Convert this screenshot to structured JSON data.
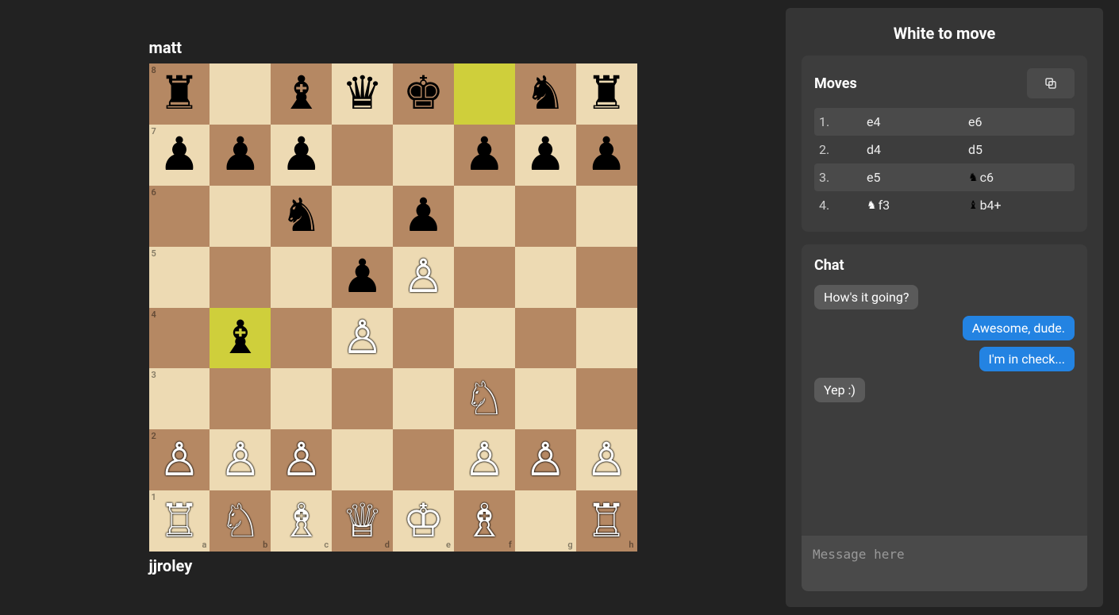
{
  "players": {
    "top": "matt",
    "bottom": "jjroley"
  },
  "turn": "White to move",
  "highlights": [
    "f8",
    "b4"
  ],
  "board": {
    "a8": "br",
    "c8": "bb",
    "d8": "bq",
    "e8": "bk",
    "g8": "bn",
    "h8": "br",
    "a7": "bp",
    "b7": "bp",
    "c7": "bp",
    "f7": "bp",
    "g7": "bp",
    "h7": "bp",
    "c6": "bn",
    "e6": "bp",
    "d5": "bp",
    "e5": "wp",
    "b4": "bb",
    "d4": "wp",
    "f3": "wn",
    "a2": "wp",
    "b2": "wp",
    "c2": "wp",
    "f2": "wp",
    "g2": "wp",
    "h2": "wp",
    "a1": "wr",
    "b1": "wn",
    "c1": "wb",
    "d1": "wq",
    "e1": "wk",
    "f1": "wb",
    "h1": "wr"
  },
  "moves_panel": {
    "title": "Moves"
  },
  "moves": [
    {
      "n": "1.",
      "w": {
        "txt": "e4"
      },
      "b": {
        "txt": "e6"
      }
    },
    {
      "n": "2.",
      "w": {
        "txt": "d4"
      },
      "b": {
        "txt": "d5"
      }
    },
    {
      "n": "3.",
      "w": {
        "txt": "e5"
      },
      "b": {
        "icon": "♞",
        "txt": "c6"
      }
    },
    {
      "n": "4.",
      "w": {
        "icon": "♞",
        "txt": "f3"
      },
      "b": {
        "icon": "♝",
        "txt": "b4+"
      }
    }
  ],
  "chat_panel": {
    "title": "Chat",
    "placeholder": "Message here"
  },
  "chat": [
    {
      "who": "theirs",
      "text": "How's it going?"
    },
    {
      "who": "mine",
      "text": "Awesome, dude."
    },
    {
      "who": "mine",
      "text": "I'm in check..."
    },
    {
      "who": "theirs",
      "text": "Yep :)"
    }
  ],
  "piece_glyphs": {
    "wk": "♔",
    "wq": "♕",
    "wr": "♖",
    "wb": "♗",
    "wn": "♘",
    "wp": "♙",
    "bk": "♚",
    "bq": "♛",
    "br": "♜",
    "bb": "♝",
    "bn": "♞",
    "bp": "♟"
  }
}
